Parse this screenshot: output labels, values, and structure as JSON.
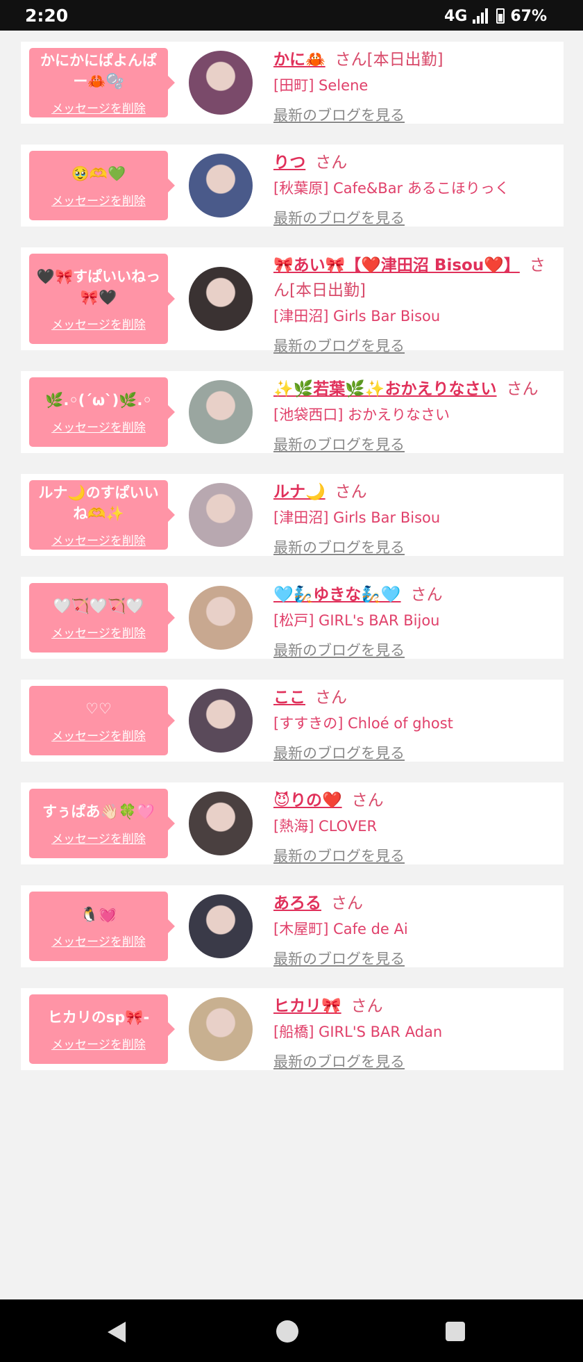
{
  "status": {
    "time": "2:20",
    "network": "4G",
    "battery": "67%"
  },
  "delete_label": "メッセージを削除",
  "blog_label": "最新のブログを見る",
  "san_label": "さん",
  "cards": [
    {
      "message": "かにかにぱよんぱー🦀🫧",
      "name": "かに🦀",
      "suffix": "[本日出勤]",
      "shop": "[田町] Selene",
      "avatar_color": "#7a4a6a"
    },
    {
      "message": "🥹🫶💚",
      "name": "りつ",
      "suffix": "",
      "shop": "[秋葉原] Cafe&Bar あるこほりっく",
      "avatar_color": "#4a5a8a"
    },
    {
      "message": "🖤🎀すぱいいねっ🎀🖤",
      "name": "🎀あい🎀【❤️津田沼 Bisou❤️】",
      "suffix": "[本日出勤]",
      "shop": "[津田沼] Girls Bar Bisou",
      "avatar_color": "#3a3232"
    },
    {
      "message": "🌿.◦(ˊωˋ)🌿.◦",
      "name": "✨🌿若葉🌿✨おかえりなさい",
      "suffix": "",
      "shop": "[池袋西口] おかえりなさい",
      "avatar_color": "#9aa6a0"
    },
    {
      "message": "ルナ🌙のすぱいいね🫶✨",
      "name": "ルナ🌙",
      "suffix": "",
      "shop": "[津田沼] Girls Bar Bisou",
      "avatar_color": "#b8a8b0"
    },
    {
      "message": "🤍🏹🤍🏹🤍",
      "name": "🩵🧞ゆきな🧞🩵",
      "suffix": "",
      "shop": "[松戸] GIRL's BAR Bijou",
      "avatar_color": "#c8a890"
    },
    {
      "message": "♡♡",
      "name": "ここ",
      "suffix": "",
      "shop": "[すすきの] Chloé of ghost",
      "avatar_color": "#5a4a5a"
    },
    {
      "message": "すぅぱあ👋🏻🍀🩷",
      "name": "😈りの❤️",
      "suffix": "",
      "shop": "[熱海] CLOVER",
      "avatar_color": "#4a4040"
    },
    {
      "message": "🐧💓",
      "name": "あろる",
      "suffix": "",
      "shop": "[木屋町] Cafe de Ai",
      "avatar_color": "#3a3a48"
    },
    {
      "message": "ヒカリのsp🎀-",
      "name": "ヒカリ🎀",
      "suffix": "",
      "shop": "[船橋] GIRL'S BAR Adan",
      "avatar_color": "#c8b090"
    }
  ]
}
